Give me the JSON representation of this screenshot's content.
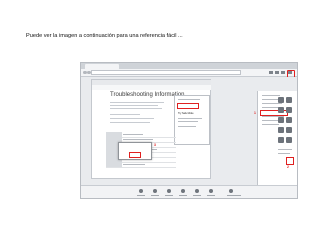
{
  "caption": "Puede ver la imagen a continuación para una referencia fácil ...",
  "screenshot": {
    "inner_title": "Troubleshooting Information",
    "side_heading": "Try Safe Mode",
    "callouts": [
      "1",
      "2",
      "3"
    ],
    "colors": {
      "highlight": "#e02020",
      "panel": "#ffffff",
      "background": "#dfe2e6"
    }
  }
}
